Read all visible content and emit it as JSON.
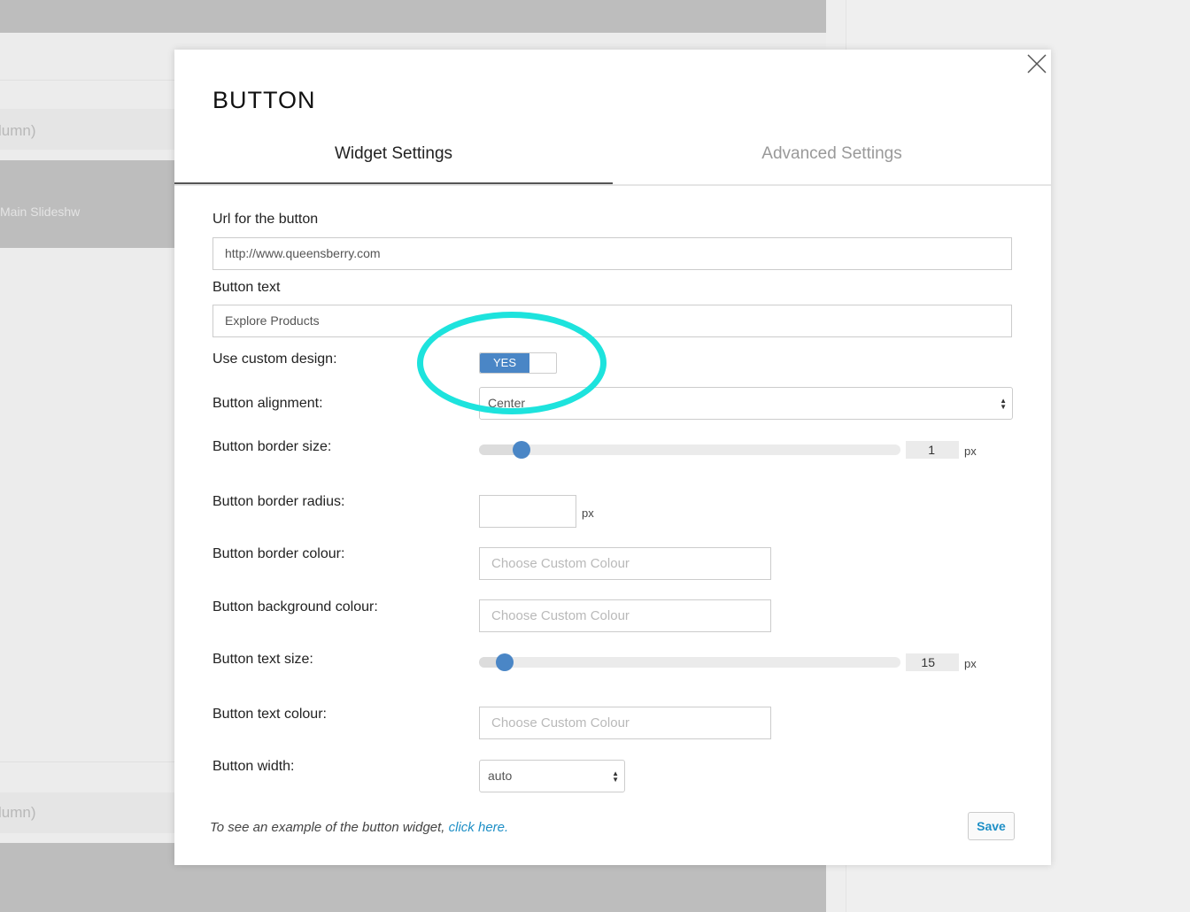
{
  "background": {
    "row1_text": "lumn)",
    "row2_text": "Main Slideshw",
    "row3_text": "lumn)"
  },
  "modal": {
    "title": "BUTTON",
    "close_icon": "close-icon",
    "tabs": [
      {
        "label": "Widget Settings",
        "active": true
      },
      {
        "label": "Advanced Settings",
        "active": false
      }
    ]
  },
  "form": {
    "url_label": "Url for the button",
    "url_value": "http://www.queensberry.com",
    "text_label": "Button text",
    "text_value": "Explore Products",
    "custom_design_label": "Use custom design:",
    "custom_design_toggle": "YES",
    "alignment_label": "Button alignment:",
    "alignment_value": "Center",
    "border_size_label": "Button border size:",
    "border_size_value": "1",
    "border_size_fraction": 0.1,
    "border_size_unit": "px",
    "border_radius_label": "Button border radius:",
    "border_radius_unit": "px",
    "border_colour_label": "Button border colour:",
    "border_colour_placeholder": "Choose Custom Colour",
    "bg_colour_label": "Button background colour:",
    "bg_colour_placeholder": "Choose Custom Colour",
    "text_size_label": "Button text size:",
    "text_size_value": "15",
    "text_size_fraction": 0.06,
    "text_size_unit": "px",
    "text_colour_label": "Button text colour:",
    "text_colour_placeholder": "Choose Custom Colour",
    "width_label": "Button width:",
    "width_value": "auto"
  },
  "footer": {
    "note": "To see an example of the button widget, ",
    "link": "click here.",
    "save_label": "Save"
  },
  "colors": {
    "accent": "#4a86c6",
    "link": "#1e8fc6",
    "highlight": "#1de3dd"
  }
}
